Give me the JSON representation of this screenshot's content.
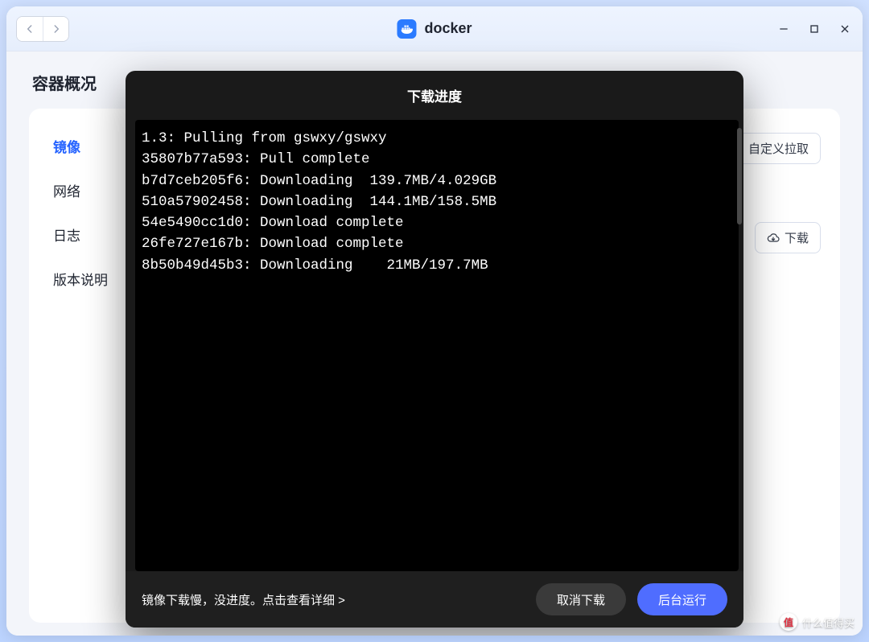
{
  "titlebar": {
    "app_name": "docker"
  },
  "section_title": "容器概况",
  "sidebar": {
    "items": [
      {
        "label": "镜像",
        "active": true
      },
      {
        "label": "网络",
        "active": false
      },
      {
        "label": "日志",
        "active": false
      },
      {
        "label": "版本说明",
        "active": false
      }
    ]
  },
  "right_actions": {
    "custom_pull": "自定义拉取",
    "download": "下载"
  },
  "modal": {
    "title": "下载进度",
    "log_lines": [
      "1.3: Pulling from gswxy/gswxy",
      "35807b77a593: Pull complete",
      "b7d7ceb205f6: Downloading  139.7MB/4.029GB",
      "510a57902458: Downloading  144.1MB/158.5MB",
      "54e5490cc1d0: Download complete",
      "26fe727e167b: Download complete",
      "8b50b49d45b3: Downloading    21MB/197.7MB"
    ],
    "hint": "镜像下载慢，没进度。点击查看详细 >",
    "cancel": "取消下载",
    "background": "后台运行"
  },
  "watermark": {
    "badge": "值",
    "text": "什么值得买"
  }
}
